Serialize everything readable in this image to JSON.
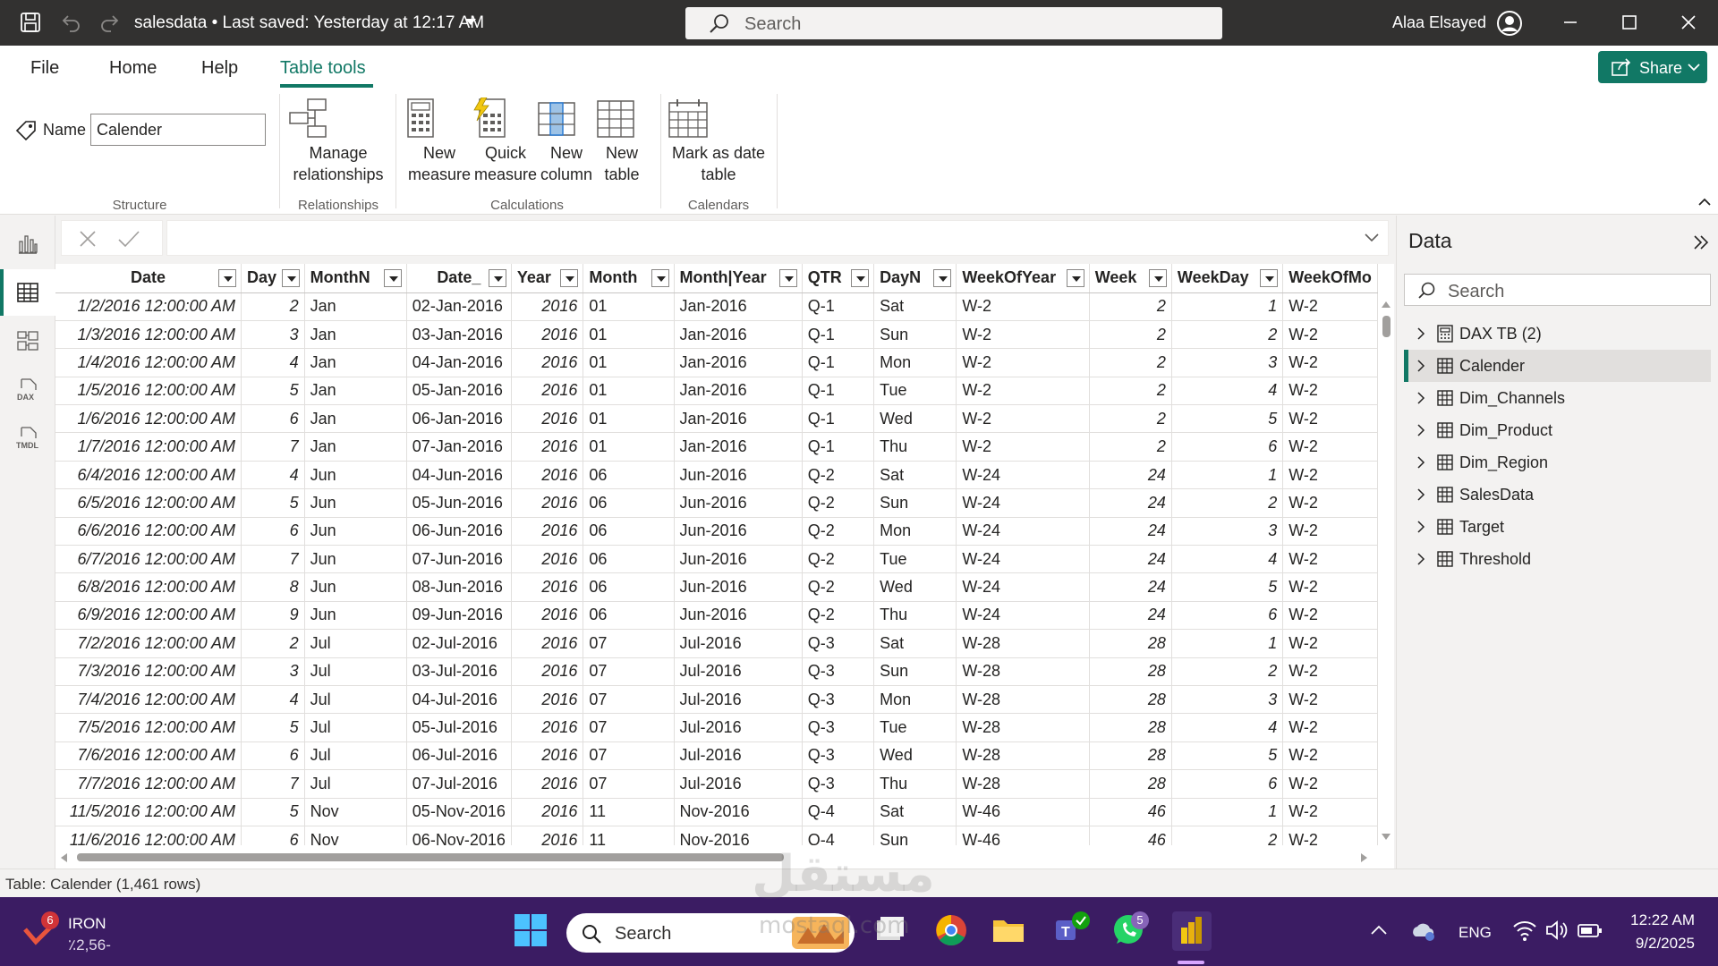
{
  "titlebar": {
    "title": "salesdata • Last saved: Yesterday at 12:17 AM",
    "search_placeholder": "Search",
    "user": "Alaa Elsayed"
  },
  "ribbon": {
    "tabs": [
      "File",
      "Home",
      "Help",
      "Table tools"
    ],
    "active_tab": "Table tools",
    "share_label": "Share",
    "name_label": "Name",
    "name_value": "Calender",
    "groups": {
      "structure": "Structure",
      "relationships": "Relationships",
      "calculations": "Calculations",
      "calendars": "Calendars"
    },
    "buttons": {
      "manage_relationships": [
        "Manage",
        "relationships"
      ],
      "new_measure": [
        "New",
        "measure"
      ],
      "quick_measure": [
        "Quick",
        "measure"
      ],
      "new_column": [
        "New",
        "column"
      ],
      "new_table": [
        "New",
        "table"
      ],
      "mark_as_date_table": [
        "Mark as date",
        "table"
      ]
    }
  },
  "grid": {
    "columns": [
      "Date",
      "Day",
      "MonthN",
      "Date_",
      "Year",
      "Month",
      "Month|Year",
      "QTR",
      "DayN",
      "WeekOfYear",
      "Week",
      "WeekDay",
      "WeekOfMo"
    ],
    "rows": [
      [
        "1/2/2016 12:00:00 AM",
        "2",
        "Jan",
        "02-Jan-2016",
        "2016",
        "01",
        "Jan-2016",
        "Q-1",
        "Sat",
        "W-2",
        "2",
        "1",
        "W-2"
      ],
      [
        "1/3/2016 12:00:00 AM",
        "3",
        "Jan",
        "03-Jan-2016",
        "2016",
        "01",
        "Jan-2016",
        "Q-1",
        "Sun",
        "W-2",
        "2",
        "2",
        "W-2"
      ],
      [
        "1/4/2016 12:00:00 AM",
        "4",
        "Jan",
        "04-Jan-2016",
        "2016",
        "01",
        "Jan-2016",
        "Q-1",
        "Mon",
        "W-2",
        "2",
        "3",
        "W-2"
      ],
      [
        "1/5/2016 12:00:00 AM",
        "5",
        "Jan",
        "05-Jan-2016",
        "2016",
        "01",
        "Jan-2016",
        "Q-1",
        "Tue",
        "W-2",
        "2",
        "4",
        "W-2"
      ],
      [
        "1/6/2016 12:00:00 AM",
        "6",
        "Jan",
        "06-Jan-2016",
        "2016",
        "01",
        "Jan-2016",
        "Q-1",
        "Wed",
        "W-2",
        "2",
        "5",
        "W-2"
      ],
      [
        "1/7/2016 12:00:00 AM",
        "7",
        "Jan",
        "07-Jan-2016",
        "2016",
        "01",
        "Jan-2016",
        "Q-1",
        "Thu",
        "W-2",
        "2",
        "6",
        "W-2"
      ],
      [
        "6/4/2016 12:00:00 AM",
        "4",
        "Jun",
        "04-Jun-2016",
        "2016",
        "06",
        "Jun-2016",
        "Q-2",
        "Sat",
        "W-24",
        "24",
        "1",
        "W-2"
      ],
      [
        "6/5/2016 12:00:00 AM",
        "5",
        "Jun",
        "05-Jun-2016",
        "2016",
        "06",
        "Jun-2016",
        "Q-2",
        "Sun",
        "W-24",
        "24",
        "2",
        "W-2"
      ],
      [
        "6/6/2016 12:00:00 AM",
        "6",
        "Jun",
        "06-Jun-2016",
        "2016",
        "06",
        "Jun-2016",
        "Q-2",
        "Mon",
        "W-24",
        "24",
        "3",
        "W-2"
      ],
      [
        "6/7/2016 12:00:00 AM",
        "7",
        "Jun",
        "07-Jun-2016",
        "2016",
        "06",
        "Jun-2016",
        "Q-2",
        "Tue",
        "W-24",
        "24",
        "4",
        "W-2"
      ],
      [
        "6/8/2016 12:00:00 AM",
        "8",
        "Jun",
        "08-Jun-2016",
        "2016",
        "06",
        "Jun-2016",
        "Q-2",
        "Wed",
        "W-24",
        "24",
        "5",
        "W-2"
      ],
      [
        "6/9/2016 12:00:00 AM",
        "9",
        "Jun",
        "09-Jun-2016",
        "2016",
        "06",
        "Jun-2016",
        "Q-2",
        "Thu",
        "W-24",
        "24",
        "6",
        "W-2"
      ],
      [
        "7/2/2016 12:00:00 AM",
        "2",
        "Jul",
        "02-Jul-2016",
        "2016",
        "07",
        "Jul-2016",
        "Q-3",
        "Sat",
        "W-28",
        "28",
        "1",
        "W-2"
      ],
      [
        "7/3/2016 12:00:00 AM",
        "3",
        "Jul",
        "03-Jul-2016",
        "2016",
        "07",
        "Jul-2016",
        "Q-3",
        "Sun",
        "W-28",
        "28",
        "2",
        "W-2"
      ],
      [
        "7/4/2016 12:00:00 AM",
        "4",
        "Jul",
        "04-Jul-2016",
        "2016",
        "07",
        "Jul-2016",
        "Q-3",
        "Mon",
        "W-28",
        "28",
        "3",
        "W-2"
      ],
      [
        "7/5/2016 12:00:00 AM",
        "5",
        "Jul",
        "05-Jul-2016",
        "2016",
        "07",
        "Jul-2016",
        "Q-3",
        "Tue",
        "W-28",
        "28",
        "4",
        "W-2"
      ],
      [
        "7/6/2016 12:00:00 AM",
        "6",
        "Jul",
        "06-Jul-2016",
        "2016",
        "07",
        "Jul-2016",
        "Q-3",
        "Wed",
        "W-28",
        "28",
        "5",
        "W-2"
      ],
      [
        "7/7/2016 12:00:00 AM",
        "7",
        "Jul",
        "07-Jul-2016",
        "2016",
        "07",
        "Jul-2016",
        "Q-3",
        "Thu",
        "W-28",
        "28",
        "6",
        "W-2"
      ],
      [
        "11/5/2016 12:00:00 AM",
        "5",
        "Nov",
        "05-Nov-2016",
        "2016",
        "11",
        "Nov-2016",
        "Q-4",
        "Sat",
        "W-46",
        "46",
        "1",
        "W-2"
      ],
      [
        "11/6/2016 12:00:00 AM",
        "6",
        "Nov",
        "06-Nov-2016",
        "2016",
        "11",
        "Nov-2016",
        "Q-4",
        "Sun",
        "W-46",
        "46",
        "2",
        "W-2"
      ]
    ]
  },
  "data_pane": {
    "title": "Data",
    "search_placeholder": "Search",
    "tables": [
      "DAX TB (2)",
      "Calender",
      "Dim_Channels",
      "Dim_Product",
      "Dim_Region",
      "SalesData",
      "Target",
      "Threshold"
    ],
    "selected": "Calender"
  },
  "status": {
    "text": "Table: Calender (1,461 rows)"
  },
  "taskbar": {
    "weather_badge": "6",
    "stock_name": "IRON",
    "stock_value": "٪2,56-",
    "search_placeholder": "Search",
    "whatsapp_badge": "5",
    "language": "ENG",
    "time": "12:22 AM",
    "date": "9/2/2025"
  },
  "watermark": {
    "arabic": "مستقل",
    "latin": "mostaql.com"
  },
  "colors": {
    "accent": "#117865",
    "titlebar": "#323130",
    "taskbar": "#3b1c63"
  }
}
